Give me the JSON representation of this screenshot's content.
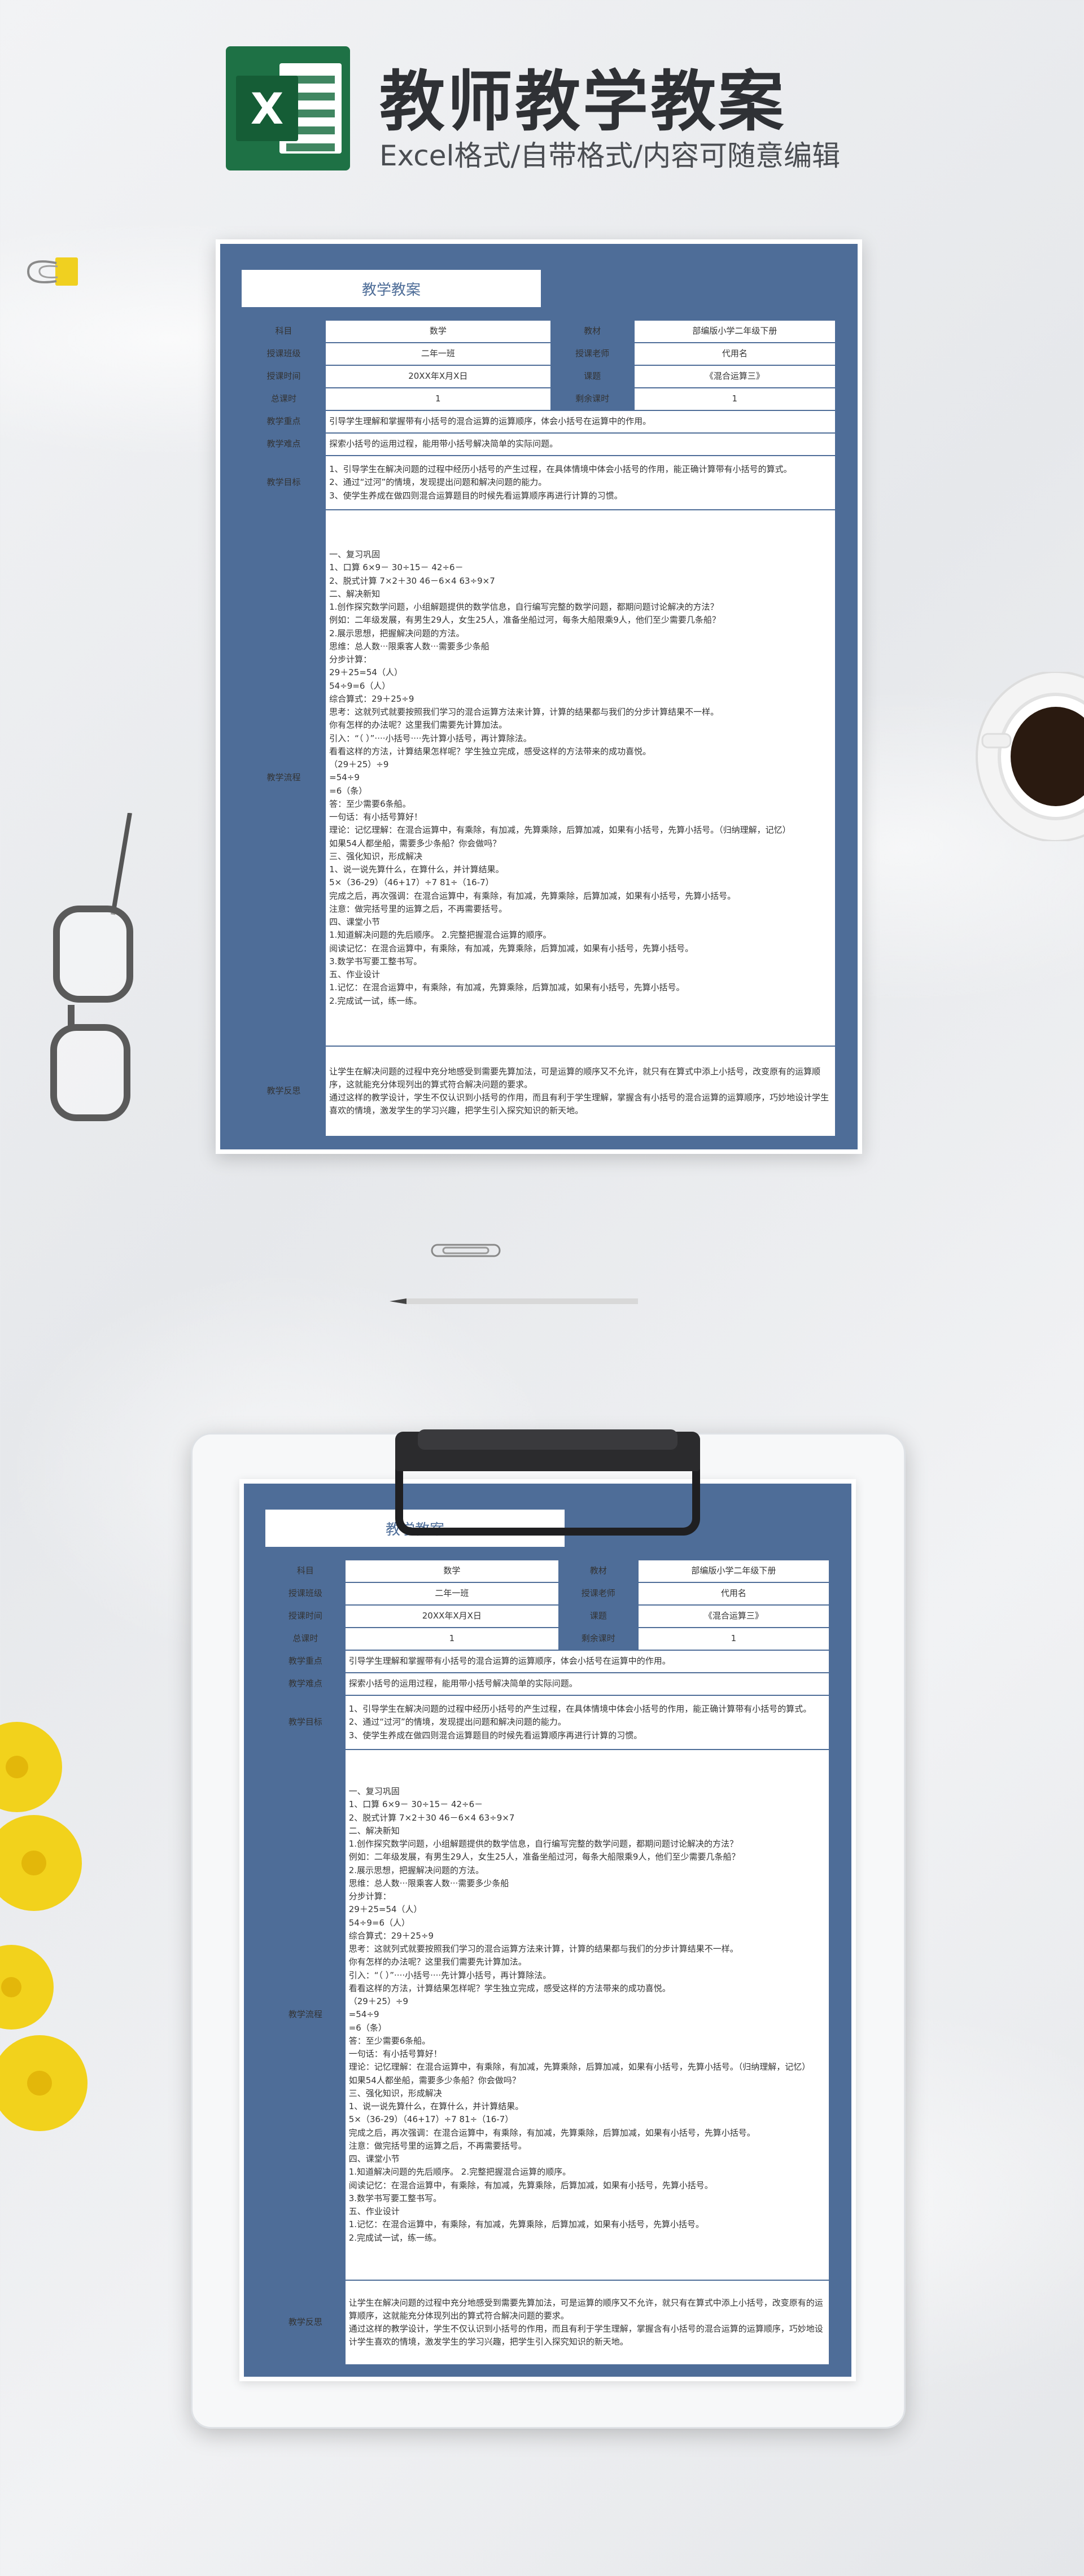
{
  "header": {
    "title": "教师教学教案",
    "subtitle": "Excel格式/自带格式/内容可随意编辑",
    "logo_letter": "X"
  },
  "colors": {
    "doc_blue": "#4e6d98",
    "excel_green": "#1e7145"
  },
  "doc": {
    "title": "教学教案",
    "labels": {
      "subject": "科目",
      "material": "教材",
      "class": "授课班级",
      "teacher": "授课老师",
      "time": "授课时间",
      "topic": "课题",
      "total": "总课时",
      "remaining": "剩余课时",
      "key": "教学重点",
      "difficulty": "教学难点",
      "goals": "教学目标",
      "process": "教学流程",
      "reflection": "教学反思"
    },
    "values": {
      "subject": "数学",
      "material": "部编版小学二年级下册",
      "class": "二年一班",
      "teacher": "代用名",
      "time": "20XX年X月X日",
      "topic": "《混合运算三》",
      "total": "1",
      "remaining": "1"
    },
    "key": "引导学生理解和掌握带有小括号的混合运算的运算顺序，体会小括号在运算中的作用。",
    "difficulty": "探索小括号的运用过程，能用带小括号解决简单的实际问题。",
    "goals": "1、引导学生在解决问题的过程中经历小括号的产生过程，在具体情境中体会小括号的作用，能正确计算带有小括号的算式。\n2、通过“过河”的情境，发现提出问题和解决问题的能力。\n3、使学生养成在做四则混合运算题目的时候先看运算顺序再进行计算的习惯。",
    "process": "一、复习巩固\n1、口算 6×9－ 30÷15－ 42÷6－\n2、脱式计算 7×2＋30 46－6×4 63÷9×7\n二、解决新知\n1.创作探究数学问题，小组解题提供的数学信息，自行编写完整的数学问题，都期问题讨论解决的方法？\n例如：二年级发展，有男生29人，女生25人，准备坐船过河，每条大船限乘9人，他们至少需要几条船？\n2.展示思想，把握解决问题的方法。\n思维：总人数···限乘客人数···需要多少条船\n分步计算：\n29＋25=54（人）\n54÷9=6（人）\n综合算式：29＋25÷9\n思考：这就列式就要按照我们学习的混合运算方法来计算，计算的结果都与我们的分步计算结果不一样。\n你有怎样的办法呢？这里我们需要先计算加法。\n引入：“（ ）”····小括号····先计算小括号，再计算除法。\n看看这样的方法，计算结果怎样呢？学生独立完成，感受这样的方法带来的成功喜悦。\n（29＋25）÷9\n=54÷9\n=6（条）\n答：至少需要6条船。\n一句话：有小括号算好！\n理论：记忆理解：在混合运算中，有乘除，有加减，先算乘除，后算加减，如果有小括号，先算小括号。（归纳理解，记忆）\n如果54人都坐船，需要多少条船？你会做吗？\n三、强化知识，形成解决\n1、说一说先算什么，在算什么，并计算结果。\n5×（36-29）（46+17）÷7 81÷（16-7）\n完成之后，再次强调：在混合运算中，有乘除，有加减，先算乘除，后算加减，如果有小括号，先算小括号。\n注意：做完括号里的运算之后，不再需要括号。\n四、课堂小节\n1.知道解决问题的先后顺序。 2.完整把握混合运算的顺序。\n阅读记忆：在混合运算中，有乘除，有加减，先算乘除，后算加减，如果有小括号，先算小括号。\n3.数学书写要工整书写。\n五、作业设计\n1.记忆：在混合运算中，有乘除，有加减，先算乘除，后算加减，如果有小括号，先算小括号。\n2.完成试一试，练一练。",
    "reflection": "让学生在解决问题的过程中充分地感受到需要先算加法，可是运算的顺序又不允许，就只有在算式中添上小括号，改变原有的运算顺序，这就能充分体现列出的算式符合解决问题的要求。\n通过这样的教学设计，学生不仅认识到小括号的作用，而且有利于学生理解，掌握含有小括号的混合运算的运算顺序，巧妙地设计学生喜欢的情境，激发学生的学习兴趣，把学生引入探究知识的新天地。"
  }
}
